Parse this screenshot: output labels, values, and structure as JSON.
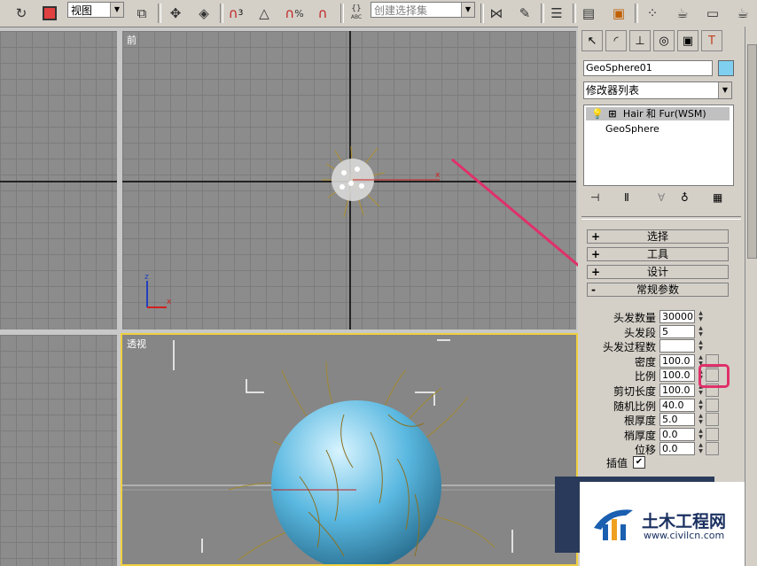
{
  "toolbar": {
    "view_dropdown": "视图",
    "selection_set_dropdown": "创建选择集",
    "abc_label": "ABC",
    "snap_angle_label": "3",
    "percent_label": "%"
  },
  "viewports": {
    "front_label": "前",
    "perspective_label": "透视",
    "axis_x": "x",
    "axis_z": "z"
  },
  "panel": {
    "object_name": "GeoSphere01",
    "object_color": "#7fd0f0",
    "modifier_list": "修改器列表",
    "stack": [
      {
        "label": "Hair 和 Fur(WSM)"
      },
      {
        "label": "GeoSphere"
      }
    ],
    "rollouts": [
      {
        "sign": "+",
        "label": "选择"
      },
      {
        "sign": "+",
        "label": "工具"
      },
      {
        "sign": "+",
        "label": "设计"
      },
      {
        "sign": "-",
        "label": "常规参数"
      }
    ],
    "params": [
      {
        "label": "头发数量",
        "value": "30000"
      },
      {
        "label": "头发段",
        "value": "5"
      },
      {
        "label": "头发过程数",
        "value": ""
      },
      {
        "label": "密度",
        "value": "100.0"
      },
      {
        "label": "比例",
        "value": "100.0"
      },
      {
        "label": "剪切长度",
        "value": "100.0"
      },
      {
        "label": "随机比例",
        "value": "40.0"
      },
      {
        "label": "根厚度",
        "value": "5.0"
      },
      {
        "label": "梢厚度",
        "value": "0.0"
      },
      {
        "label": "位移",
        "value": "0.0"
      }
    ],
    "interpolate_label": "插值",
    "interpolate_check": "✔"
  },
  "watermark": {
    "title": "土木工程网",
    "url": "www.civilcn.com"
  },
  "colors": {
    "annotation": "#e0306a",
    "selected_border": "#f0d040",
    "sphere": "#5ab8e0"
  }
}
